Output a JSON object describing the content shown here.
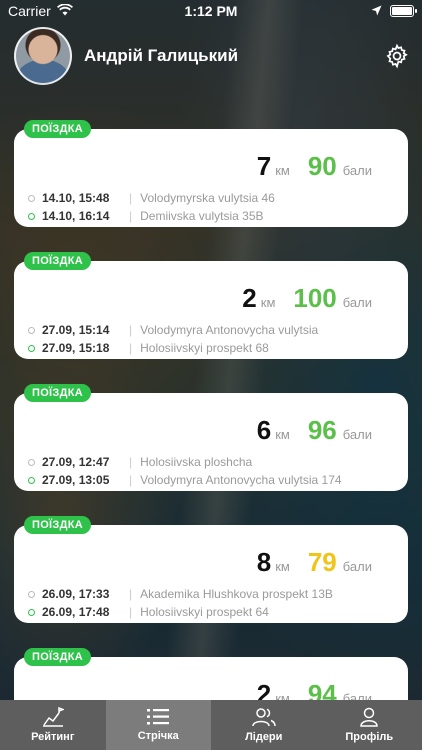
{
  "status": {
    "carrier": "Carrier",
    "time": "1:12 PM"
  },
  "header": {
    "user_name": "Андрій Галицький"
  },
  "colors": {
    "accent_green": "#2fc24a",
    "points_green": "#5bbf4a",
    "points_yellow": "#f0c419"
  },
  "trips": [
    {
      "badge": "ПОЇЗДКА",
      "km": "7",
      "km_unit": "км",
      "points": "90",
      "points_unit": "бали",
      "points_color": "green",
      "start_time": "14.10, 15:48",
      "start_addr": "Volodymyrska vulytsia 46",
      "end_time": "14.10, 16:14",
      "end_addr": "Demiivska vulytsia 35B"
    },
    {
      "badge": "ПОЇЗДКА",
      "km": "2",
      "km_unit": "км",
      "points": "100",
      "points_unit": "бали",
      "points_color": "green",
      "start_time": "27.09, 15:14",
      "start_addr": "Volodymyra Antonovycha vulytsia",
      "end_time": "27.09, 15:18",
      "end_addr": "Holosiivskyi prospekt 68"
    },
    {
      "badge": "ПОЇЗДКА",
      "km": "6",
      "km_unit": "км",
      "points": "96",
      "points_unit": "бали",
      "points_color": "green",
      "start_time": "27.09, 12:47",
      "start_addr": "Holosiivska ploshcha",
      "end_time": "27.09, 13:05",
      "end_addr": "Volodymyra Antonovycha vulytsia 174"
    },
    {
      "badge": "ПОЇЗДКА",
      "km": "8",
      "km_unit": "км",
      "points": "79",
      "points_unit": "бали",
      "points_color": "yellow",
      "start_time": "26.09, 17:33",
      "start_addr": "Akademika Hlushkova prospekt 13B",
      "end_time": "26.09, 17:48",
      "end_addr": "Holosiivskyi prospekt 64"
    },
    {
      "badge": "ПОЇЗДКА",
      "km": "2",
      "km_unit": "км",
      "points": "94",
      "points_unit": "бали",
      "points_color": "green",
      "start_time": "",
      "start_addr": "",
      "end_time": "",
      "end_addr": ""
    }
  ],
  "tabs": [
    {
      "label": "Рейтинг",
      "icon": "chart-flag-icon",
      "active": false
    },
    {
      "label": "Стрічка",
      "icon": "list-icon",
      "active": true
    },
    {
      "label": "Лідери",
      "icon": "users-icon",
      "active": false
    },
    {
      "label": "Профіль",
      "icon": "person-icon",
      "active": false
    }
  ]
}
